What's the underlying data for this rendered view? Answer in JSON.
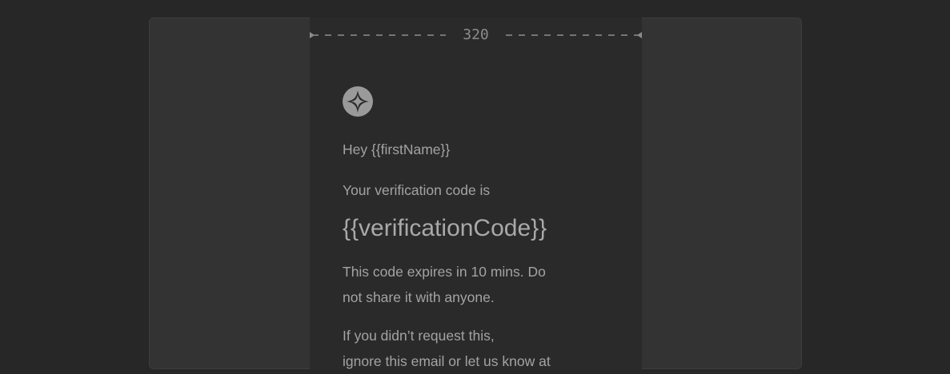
{
  "ruler": {
    "width_value": "320"
  },
  "email": {
    "logo_icon": "sparkle-logo-icon",
    "greeting": "Hey {{firstName}}",
    "intro": "Your verification code is",
    "code": "{{verificationCode}}",
    "expiry_line_1": "This code expires in 10 mins. Do",
    "expiry_line_2": "not share it with anyone.",
    "ignore_line_1": "If you didn’t request this,",
    "ignore_line_2": "ignore this email or let us know at"
  },
  "colors": {
    "background": "#272727",
    "frame": "#333333",
    "email_column": "#2a2a2a",
    "text": "#a3a3a3",
    "logo": "#9a9a9a"
  }
}
